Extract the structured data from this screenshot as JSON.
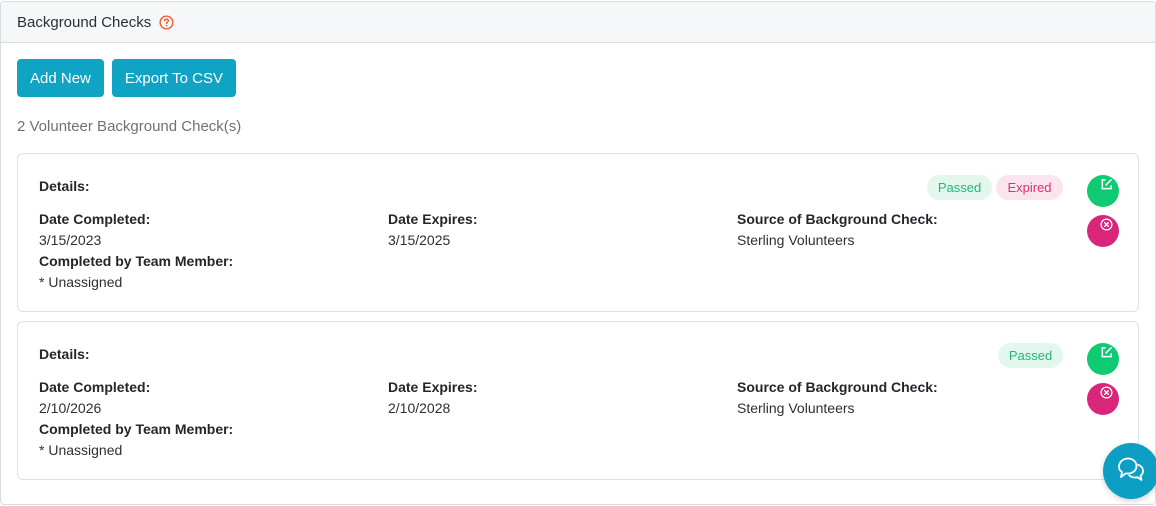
{
  "header": {
    "title": "Background Checks",
    "help_icon": "question-circle-icon",
    "help_color": "#e8542c"
  },
  "toolbar": {
    "add_label": "Add New",
    "export_label": "Export To CSV",
    "button_color": "#0fa3c4"
  },
  "summary": {
    "count_text": "2 Volunteer Background Check(s)"
  },
  "checks": [
    {
      "details_label": "Details:",
      "date_completed_label": "Date Completed:",
      "date_completed": "3/15/2023",
      "date_expires_label": "Date Expires:",
      "date_expires": "3/15/2025",
      "source_label": "Source of Background Check:",
      "source": "Sterling Volunteers",
      "completed_by_label": "Completed by Team Member:",
      "completed_by": "* Unassigned",
      "badges": [
        "Passed",
        "Expired"
      ]
    },
    {
      "details_label": "Details:",
      "date_completed_label": "Date Completed:",
      "date_completed": "2/10/2026",
      "date_expires_label": "Date Expires:",
      "date_expires": "2/10/2028",
      "source_label": "Source of Background Check:",
      "source": "Sterling Volunteers",
      "completed_by_label": "Completed by Team Member:",
      "completed_by": "* Unassigned",
      "badges": [
        "Passed"
      ]
    }
  ],
  "colors": {
    "passed": "#1fb87a",
    "expired": "#d9336f",
    "edit": "#0fca72",
    "delete": "#d9267a",
    "chat": "#0d9ec4"
  },
  "icons": {
    "edit": "edit-icon",
    "delete": "close-circle-icon",
    "chat": "chat-bubbles-icon"
  }
}
